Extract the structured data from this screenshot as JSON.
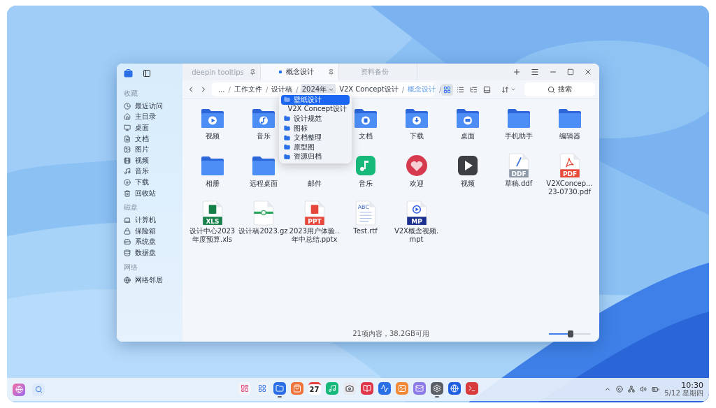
{
  "tabs": [
    {
      "label": "deepin tooltips",
      "selected": false,
      "pinned": true
    },
    {
      "label": "概念设计",
      "selected": true,
      "pinned": true
    },
    {
      "label": "资料备份",
      "selected": false,
      "pinned": false
    }
  ],
  "breadcrumb": {
    "segments": [
      {
        "label": "...",
        "suffix": "/"
      },
      {
        "label": "工作文件",
        "suffix": "/"
      },
      {
        "label": "设计稿",
        "suffix": "/"
      },
      {
        "label": "2024年",
        "menu_open": true
      },
      {
        "label": "V2X Concept设计",
        "suffix": "/"
      },
      {
        "label": "概念设计",
        "suffix": "/",
        "current": true
      }
    ],
    "menu": {
      "items": [
        {
          "label": "壁纸设计",
          "selected": true
        },
        {
          "label": "V2X Concept设计",
          "selected": false
        },
        {
          "label": "设计规范",
          "selected": false
        },
        {
          "label": "图标",
          "selected": false
        },
        {
          "label": "文档整理",
          "selected": false
        },
        {
          "label": "原型图",
          "selected": false
        },
        {
          "label": "资源归档",
          "selected": false
        }
      ]
    }
  },
  "view_modes": [
    {
      "kind": "icons",
      "selected": true
    },
    {
      "kind": "list",
      "selected": false
    },
    {
      "kind": "tree",
      "selected": false
    },
    {
      "kind": "preview",
      "selected": false
    }
  ],
  "search": {
    "placeholder": "搜索"
  },
  "sidebar": {
    "groups": [
      {
        "title": "收藏",
        "items": [
          {
            "label": "最近访问",
            "kind": "recent"
          },
          {
            "label": "主目录",
            "kind": "home"
          },
          {
            "label": "桌面",
            "kind": "desktop"
          },
          {
            "label": "文档",
            "kind": "documents"
          },
          {
            "label": "图片",
            "kind": "pictures"
          },
          {
            "label": "视频",
            "kind": "videos"
          },
          {
            "label": "音乐",
            "kind": "music"
          },
          {
            "label": "下载",
            "kind": "downloads"
          },
          {
            "label": "回收站",
            "kind": "trash"
          }
        ]
      },
      {
        "title": "磁盘",
        "items": [
          {
            "label": "计算机",
            "kind": "computer"
          },
          {
            "label": "保险箱",
            "kind": "vault"
          },
          {
            "label": "系统盘",
            "kind": "system-disk"
          },
          {
            "label": "数据盘",
            "kind": "data-disk"
          }
        ]
      },
      {
        "title": "网络",
        "items": [
          {
            "label": "网络邻居",
            "kind": "network"
          }
        ]
      }
    ]
  },
  "files": [
    {
      "name": "视频",
      "kind": "folder-video"
    },
    {
      "name": "音乐",
      "kind": "folder-music"
    },
    {
      "kind": "covered"
    },
    {
      "name": "文档",
      "kind": "folder-documents"
    },
    {
      "name": "下载",
      "kind": "folder-downloads"
    },
    {
      "name": "桌面",
      "kind": "folder-desktop"
    },
    {
      "name": "手机助手",
      "kind": "folder"
    },
    {
      "name": "编辑器",
      "kind": "folder"
    },
    {
      "name": "相册",
      "kind": "folder"
    },
    {
      "name": "远程桌面",
      "kind": "folder"
    },
    {
      "name": "邮件",
      "kind": "covered"
    },
    {
      "name": "音乐",
      "kind": "app-music"
    },
    {
      "name": "欢迎",
      "kind": "app-welcome"
    },
    {
      "name": "视频",
      "kind": "app-video"
    },
    {
      "name": "草稿.ddf",
      "kind": "doc-draft",
      "badge": "DDF"
    },
    {
      "name": "V2XConcep...23-0730.pdf",
      "kind": "doc-pdf",
      "badge": "PDF"
    },
    {
      "name": "设计中心2023年度预算.xls",
      "kind": "doc-sheet",
      "badge": "XLS"
    },
    {
      "name": "设计稿2023.gz",
      "kind": "doc-archive"
    },
    {
      "name": "2023用户体验..年中总结.pptx",
      "kind": "doc-slides",
      "badge": "PPT"
    },
    {
      "name": "Test.rtf",
      "kind": "doc-text",
      "badge": "ABC"
    },
    {
      "name": "V2X概念视频.mpt",
      "kind": "doc-video",
      "badge": "MP"
    }
  ],
  "status_bar": {
    "text": "21项内容，38.2GB可用",
    "icon_size": {
      "level": 0.52
    }
  },
  "taskbar": {
    "apps": [
      {
        "kind": "launcher",
        "running": false
      },
      {
        "kind": "multitask",
        "running": false
      },
      {
        "kind": "files",
        "running": true
      },
      {
        "kind": "store",
        "running": false
      },
      {
        "kind": "calendar",
        "label": "27",
        "running": false
      },
      {
        "kind": "music",
        "running": false
      },
      {
        "kind": "camera",
        "running": false
      },
      {
        "kind": "reader",
        "running": false
      },
      {
        "kind": "monitor",
        "running": false
      },
      {
        "kind": "album",
        "running": false
      },
      {
        "kind": "mail",
        "running": false
      },
      {
        "kind": "settings",
        "running": true
      },
      {
        "kind": "browser",
        "running": false
      },
      {
        "kind": "terminal",
        "running": false
      }
    ],
    "clock": {
      "time": "10:30",
      "date": "5/12 星期四"
    }
  }
}
